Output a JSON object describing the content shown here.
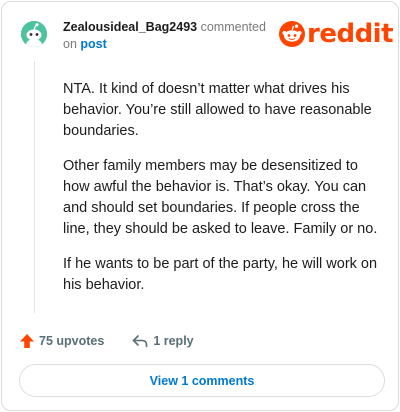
{
  "comment": {
    "username": "Zealousideal_Bag2493",
    "action_text": "commented",
    "on_text": "on",
    "post_link": "post",
    "paragraphs": [
      "NTA. It kind of doesn’t matter what drives his behavior. You’re still allowed to have reasonable boundaries.",
      "Other family members may be desensitized to how awful the behavior is. That’s okay. You can and should set boundaries. If people cross the line, they should be asked to leave. Family or no.",
      "If he wants to be part of the party, he will work on his behavior."
    ],
    "upvotes": "75 upvotes",
    "replies": "1 reply",
    "view_comments": "View 1 comments"
  },
  "brand": {
    "logo_text": "reddit",
    "accent_color": "#ff4500",
    "link_color": "#0079d3"
  },
  "icons": {
    "avatar": "snoo-avatar",
    "logo": "reddit-snoo-logo-icon",
    "upvote": "upvote-arrow-icon",
    "reply": "reply-arrow-icon"
  }
}
